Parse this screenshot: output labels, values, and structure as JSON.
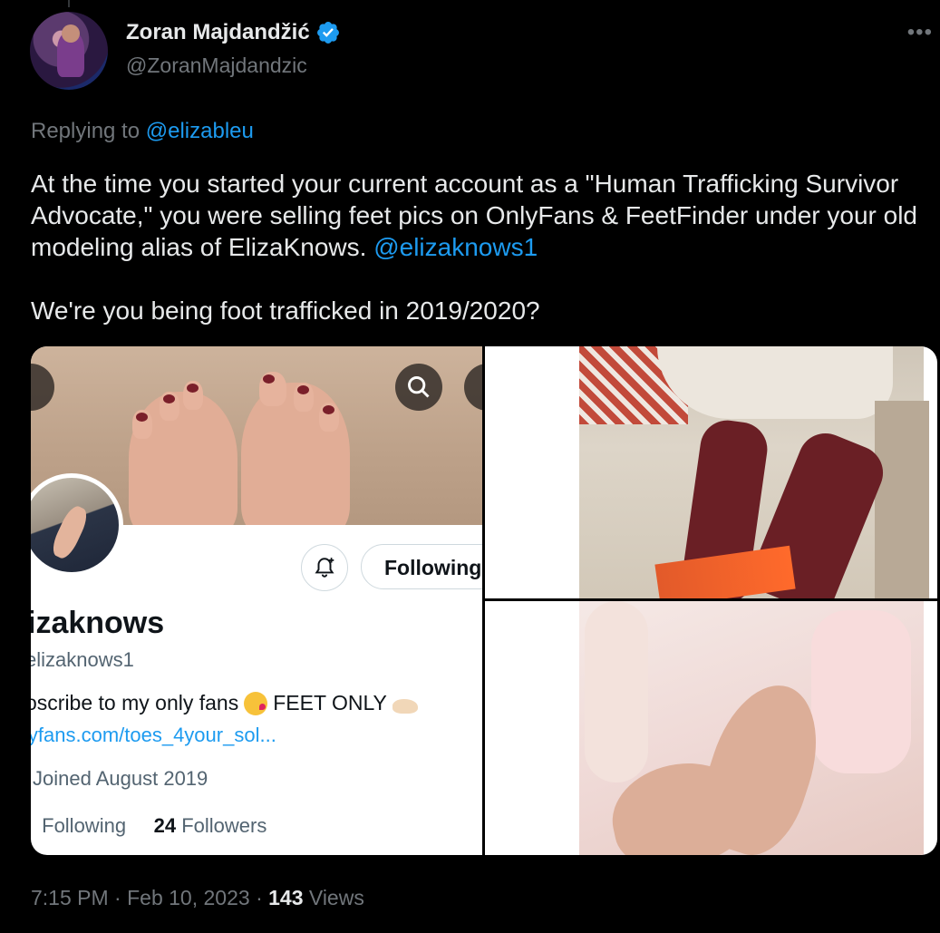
{
  "author": {
    "display_name": "Zoran Majdandžić",
    "handle": "@ZoranMajdandzic",
    "verified": true
  },
  "more_icon": "more-horizontal-icon",
  "reply": {
    "prefix": "Replying to",
    "mention": "@elizableu"
  },
  "body": {
    "paragraph1_text": "At the time you started your current account as a \"Human Trafficking Survivor Advocate,\" you were selling feet pics on OnlyFans & FeetFinder under your old modeling alias of ElizaKnows.",
    "paragraph1_mention": "@elizaknows1",
    "paragraph2": "We're you being foot trafficked in 2019/2020?"
  },
  "profile_screenshot": {
    "name": "izaknows",
    "handle": "elizaknows1",
    "bio_text": "oscribe to my only fans",
    "bio_suffix": "FEET ONLY",
    "url": "lyfans.com/toes_4your_sol...",
    "joined": "Joined August 2019",
    "following_label": "Following",
    "followers_count": "24",
    "followers_label": "Followers",
    "follow_button": "Following"
  },
  "meta": {
    "time": "7:15 PM",
    "date": "Feb 10, 2023",
    "views_count": "143",
    "views_label": "Views",
    "separator": "·"
  },
  "colors": {
    "background": "#000000",
    "text": "#e7e9ea",
    "secondary": "#71767b",
    "link": "#1d9bf0",
    "verified": "#1d9bf0"
  }
}
